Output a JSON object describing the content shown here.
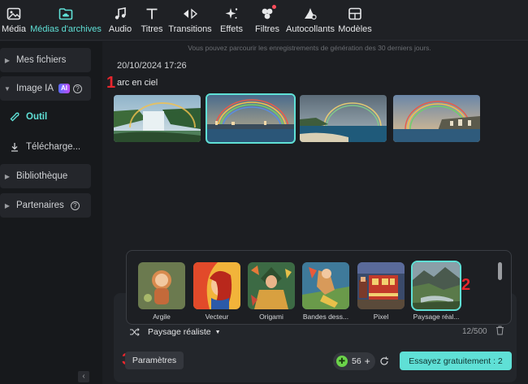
{
  "toolbar": {
    "items": [
      {
        "label": "Média",
        "icon": "media-icon"
      },
      {
        "label": "Médias d'archives",
        "icon": "folder-cloud-icon",
        "active": true
      },
      {
        "label": "Audio",
        "icon": "music-note-icon"
      },
      {
        "label": "Titres",
        "icon": "text-t-icon"
      },
      {
        "label": "Transitions",
        "icon": "transitions-icon"
      },
      {
        "label": "Effets",
        "icon": "sparkle-icon"
      },
      {
        "label": "Filtres",
        "icon": "filters-icon",
        "badge": true
      },
      {
        "label": "Autocollants",
        "icon": "sticker-icon"
      },
      {
        "label": "Modèles",
        "icon": "template-icon"
      }
    ]
  },
  "sidebar": {
    "my_files": "Mes fichiers",
    "ai_image": "Image IA",
    "ai_badge": "AI",
    "tool": "Outil",
    "downloads": "Télécharge...",
    "library": "Bibliothèque",
    "partners": "Partenaires"
  },
  "main": {
    "notice": "Vous pouvez parcourir les enregistrements de génération des 30 derniers jours.",
    "timestamp": "20/10/2024 17:26",
    "prompt": "arc en ciel",
    "markers": {
      "one": "1",
      "two": "2",
      "three": "3"
    }
  },
  "styles": [
    {
      "name": "Argile"
    },
    {
      "name": "Vecteur"
    },
    {
      "name": "Origami"
    },
    {
      "name": "Bandes dess..."
    },
    {
      "name": "Pixel"
    },
    {
      "name": "Paysage réal...",
      "selected": true
    }
  ],
  "style_bar": {
    "selected": "Paysage réaliste",
    "counter": "12/500"
  },
  "actions": {
    "params": "Paramètres",
    "credits": "56",
    "try": "Essayez gratuitement : 2"
  },
  "colors": {
    "accent": "#5fe0d6",
    "marker": "#e8262d"
  }
}
